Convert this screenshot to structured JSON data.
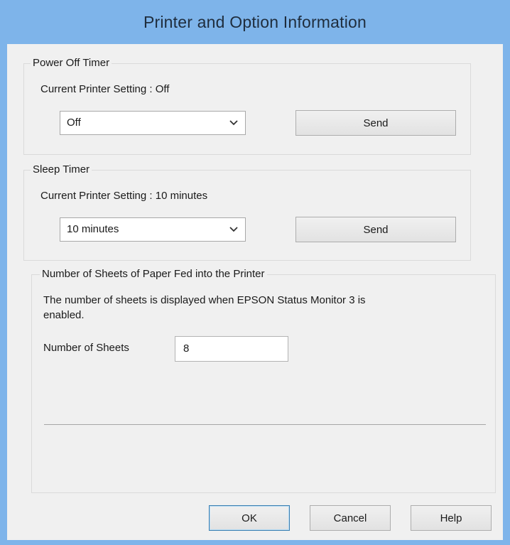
{
  "window": {
    "title": "Printer and Option Information"
  },
  "power_off_timer": {
    "legend": "Power Off Timer",
    "current_setting": "Current Printer Setting : Off",
    "selected": "Off",
    "send_label": "Send"
  },
  "sleep_timer": {
    "legend": "Sleep Timer",
    "current_setting": "Current Printer Setting : 10 minutes",
    "selected": "10 minutes",
    "send_label": "Send"
  },
  "sheets": {
    "legend": "Number of Sheets of Paper Fed into the Printer",
    "description_line1": "The number of sheets is displayed when EPSON Status Monitor 3 is",
    "description_line2": "enabled.",
    "label": "Number of Sheets",
    "value": "8"
  },
  "footer": {
    "ok_label": "OK",
    "cancel_label": "Cancel",
    "help_label": "Help"
  },
  "colors": {
    "title_bar": "#7eb4ea",
    "client_background": "#f0f0f0",
    "default_button_border": "#3c7fb1"
  },
  "icons": {
    "combo_arrow": "chevron-down-icon"
  }
}
